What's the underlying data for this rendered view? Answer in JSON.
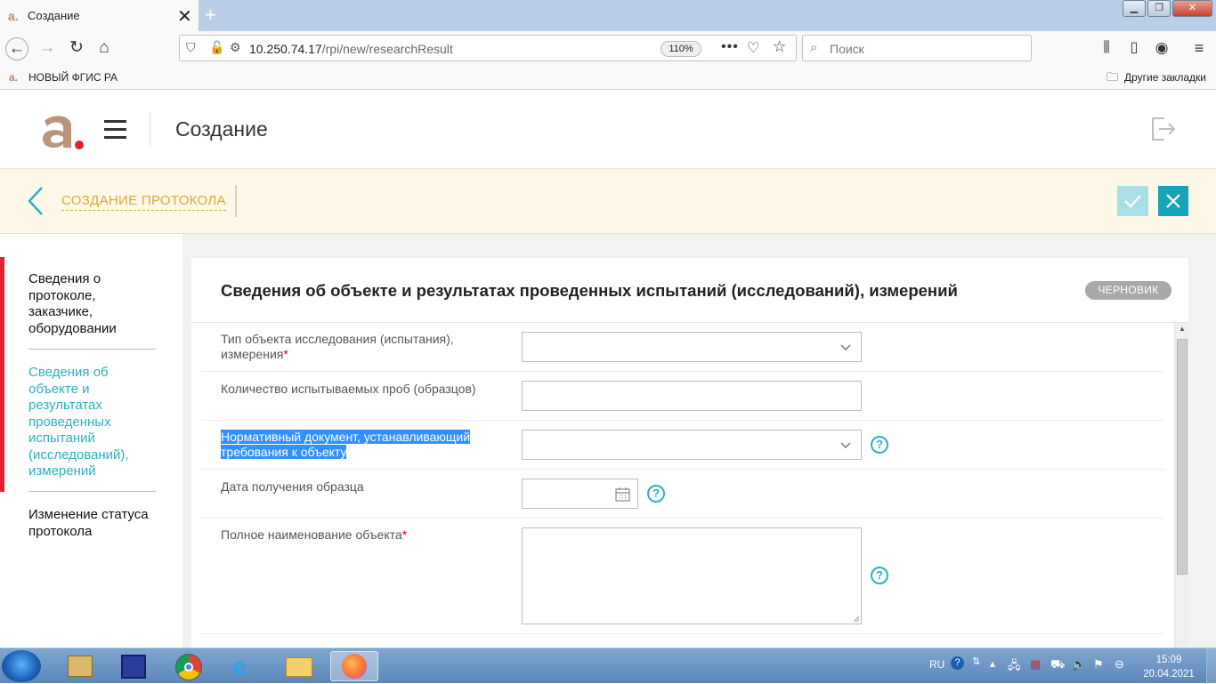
{
  "browser": {
    "tab_title": "Создание",
    "tab_close": "✕",
    "new_tab": "+",
    "url_host": "10.250.74.17",
    "url_path": "/rpi/new/researchResult",
    "zoom": "110%",
    "search_placeholder": "Поиск",
    "bookmark_left": "НОВЫЙ ФГИС РА",
    "bookmark_right": "Другие закладки"
  },
  "header": {
    "page_title": "Создание"
  },
  "actionbar": {
    "breadcrumb_title": "СОЗДАНИЕ ПРОТОКОЛА"
  },
  "nav": {
    "items": [
      {
        "label": "Сведения о протоколе, заказчике, оборудовании"
      },
      {
        "label": "Сведения об объекте и результатах проведенных испытаний (исследований), измерений"
      },
      {
        "label": "Изменение статуса протокола"
      }
    ]
  },
  "panel": {
    "title": "Сведения об объекте и результатах проведенных испытаний (исследований), измерений",
    "status_badge": "ЧЕРНОВИК",
    "fields": [
      {
        "label": "Тип объекта исследования (испытания), измерения",
        "required": "*",
        "type": "select",
        "value": ""
      },
      {
        "label": "Количество испытываемых проб (образцов)",
        "type": "text",
        "value": ""
      },
      {
        "label": "Нормативный документ, устанавливающий требования к объекту",
        "type": "select",
        "value": "",
        "selected": true
      },
      {
        "label": "Дата получения образца",
        "type": "date",
        "value": ""
      },
      {
        "label": "Полное наименование объекта",
        "required": "*",
        "type": "textarea",
        "value": ""
      }
    ],
    "help_glyph": "?"
  },
  "taskbar": {
    "language": "RU",
    "time": "15:09",
    "date": "20.04.2021"
  },
  "colors": {
    "accent": "#2bb0c2",
    "required": "#d0021b",
    "nav_marker": "#e5202c",
    "breadcrumb": "#d8a93b",
    "action_bar_bg": "#fdf8e7",
    "selection": "#3390ff"
  }
}
